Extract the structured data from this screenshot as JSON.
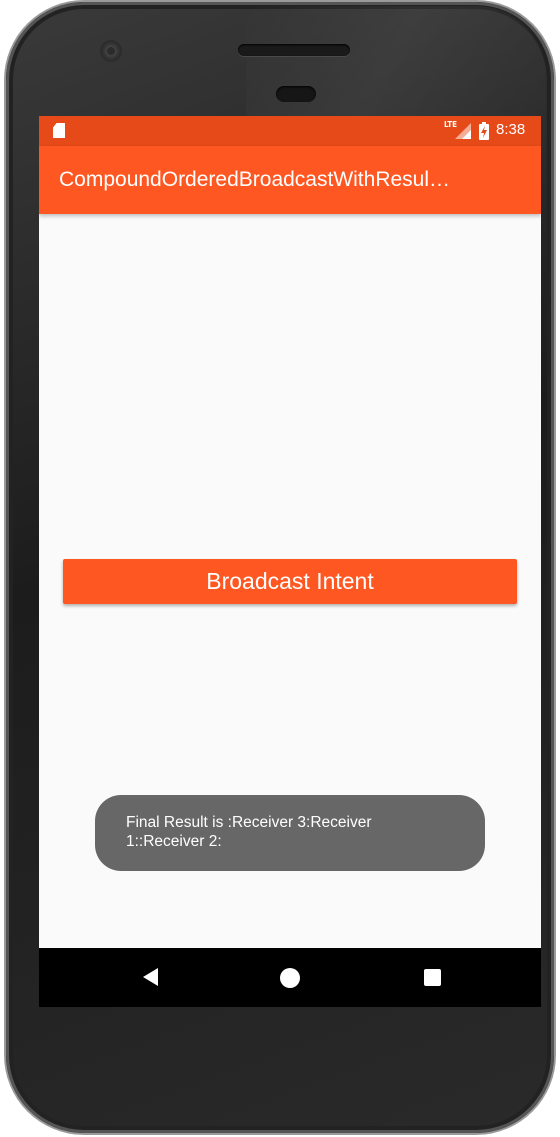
{
  "status_bar": {
    "time": "8:38",
    "network": "LTE",
    "icons": [
      "sd-card-icon",
      "lte-signal-icon",
      "battery-charging-icon"
    ]
  },
  "app_bar": {
    "title": "CompoundOrderedBroadcastWithResul…"
  },
  "main": {
    "broadcast_button_label": "Broadcast Intent"
  },
  "toast": {
    "message": "Final Result is :Receiver 3:Receiver 1::Receiver 2:"
  },
  "nav_bar": {
    "icons": [
      "back-icon",
      "home-icon",
      "recents-icon"
    ]
  },
  "colors": {
    "primary": "#ff5722",
    "primary_dark": "#e64a19",
    "toast_bg": "#676767",
    "screen_bg": "#fafafa"
  }
}
